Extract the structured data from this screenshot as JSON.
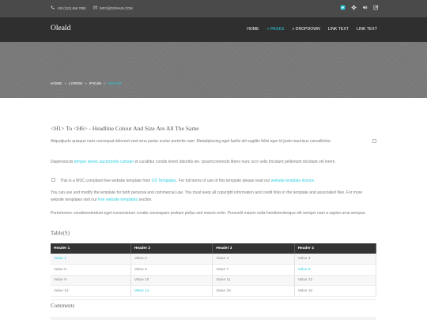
{
  "topbar": {
    "phone": "+00 (123) 456 7890",
    "email": "INFO@DOMAIN.COM",
    "social_icons": [
      "twitter-icon",
      "gear-icon",
      "volume-icon",
      "pencil-icon"
    ]
  },
  "nav": {
    "logo": "Oleald",
    "items": [
      {
        "label": "HOME",
        "active": false
      },
      {
        "label": "» PAGES",
        "active": true
      },
      {
        "label": "» DROPDOWN",
        "active": false
      },
      {
        "label": "LINK TEXT",
        "active": false
      },
      {
        "label": "LINK TEXT",
        "active": false
      }
    ]
  },
  "breadcrumb": {
    "items": [
      "HOME",
      "LOREM",
      "IPSUM"
    ],
    "separator": "»",
    "current": "DOLOR"
  },
  "main": {
    "heading": "<H1> To <H6> - Headline Colour And Size Are All The Same",
    "para1": "Aliquatjusto quisque nam consequat doloreet vest orna partur scetur portortis nam. Metadipiscing eget facilis elit sagittis felisi eger id justo maurisus convallicitur.",
    "para2_before": "Dapiensociis ",
    "para2_link": "temper donec auctortorlis cumsan",
    "para2_after": " et curabitur condis lorem loborttis leo. Ipsumcommodo libero nunc at in velis tincidunt pellentum tincidunt vel lorem.",
    "para3_before": "This is a W3C compliant free website template from ",
    "para3_link1": "OS Templates",
    "para3_middle": ". For full terms of use of this template please read our ",
    "para3_link2": "website template licence",
    "para3_after": ".",
    "para4_before": "You can use and modify the template for both personal and commercial use. You must keep all copyright information and credit links in the template and associated files. For more website templates visit our ",
    "para4_link": "free website templates",
    "para4_after": " section.",
    "para5": "Portortornec condimenterdum eget consectetuer condis consequam pretium pellus sed mauris enim. Puruselit mauris nulla hendimentesque elit semper nam a sapien urna sempus.",
    "table_title": "Table(S)",
    "comments_title": "Comments"
  },
  "table": {
    "headers": [
      "Header 1",
      "Header 2",
      "Header 3",
      "Header 4"
    ],
    "rows": [
      [
        "Value 1",
        "Value 2",
        "Value 3",
        "Value 4"
      ],
      [
        "Value 5",
        "Value 6",
        "Value 7",
        "Value 8"
      ],
      [
        "Value 9",
        "Value 10",
        "Value 11",
        "Value 12"
      ],
      [
        "Value 13",
        "Value 14",
        "Value 15",
        "Value 16"
      ]
    ]
  },
  "colors": {
    "accent": "#2ccde0",
    "nav_bg": "#2f2f2f",
    "topbar_bg": "#4a4a4a",
    "table_header_bg": "#333333"
  }
}
